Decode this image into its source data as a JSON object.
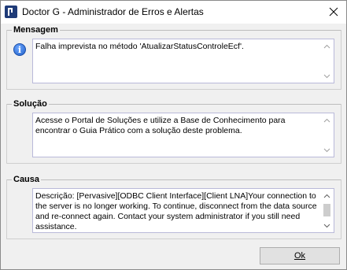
{
  "window": {
    "title": "Doctor G - Administrador de Erros e Alertas"
  },
  "mensagem": {
    "label": "Mensagem",
    "text": "Falha imprevista no método 'AtualizarStatusControleEcf'."
  },
  "solucao": {
    "label": "Solução",
    "text": "Acesse o Portal de Soluções e utilize a Base de Conhecimento para encontrar o Guia Prático com a solução deste problema."
  },
  "causa": {
    "label": "Causa",
    "text": "Descrição: [Pervasive][ODBC Client Interface][Client LNA]Your connection to the server is no longer working. To continue, disconnect from the data source and re-connect again. Contact your system administrator if you still need assistance.",
    "scroll_position": 0.2
  },
  "buttons": {
    "ok_label": "Ok"
  },
  "icons": {
    "app": "doctor-g-app-icon",
    "info": "info-icon",
    "close": "close-icon"
  }
}
